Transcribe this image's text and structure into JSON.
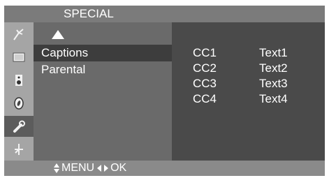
{
  "header": {
    "title": "SPECIAL"
  },
  "sidebar": {
    "icons": [
      {
        "name": "antenna-icon",
        "active": false
      },
      {
        "name": "screen-icon",
        "active": false
      },
      {
        "name": "speaker-icon",
        "active": false
      },
      {
        "name": "clock-icon",
        "active": false
      },
      {
        "name": "special-wrench-icon",
        "active": true
      },
      {
        "name": "setup-icon",
        "active": false
      }
    ]
  },
  "menu": {
    "items": [
      {
        "label": "Captions",
        "selected": true
      },
      {
        "label": "Parental",
        "selected": false
      }
    ]
  },
  "options": [
    {
      "cc": "CC1",
      "text": "Text1"
    },
    {
      "cc": "CC2",
      "text": "Text2"
    },
    {
      "cc": "CC3",
      "text": "Text3"
    },
    {
      "cc": "CC4",
      "text": "Text4"
    }
  ],
  "footer": {
    "menu_label": "MENU",
    "ok_label": "OK"
  },
  "colors": {
    "background": "#4a4a4a",
    "title_bar": "#7b7b7b",
    "icon_column": "#a5a5a5",
    "menu_column": "#6a6a6a",
    "selected_item": "#3d3d3d",
    "footer": "#8a8a8a",
    "text": "#ffffff"
  }
}
